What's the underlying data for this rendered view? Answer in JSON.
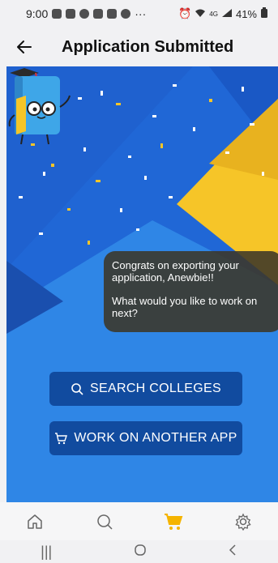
{
  "status_bar": {
    "time": "9:00",
    "battery": "41%",
    "network": "4G"
  },
  "app_bar": {
    "title": "Application Submitted",
    "back_icon": "arrow-left-icon"
  },
  "message": {
    "line1": "Congrats on exporting your application, Anewbie!!",
    "line2": "What would you like to work on next?"
  },
  "actions": {
    "search_colleges": "SEARCH COLLEGES",
    "work_on_another_app": "WORK ON ANOTHER APP"
  },
  "bottom_nav": {
    "items": [
      "home",
      "search",
      "cart",
      "settings"
    ],
    "active": "cart",
    "active_color": "#f5b400"
  },
  "colors": {
    "hero_blue": "#2f86e6",
    "hero_dark": "#1c5fc9",
    "hero_yellow": "#f6c528",
    "button": "#114b9f"
  }
}
